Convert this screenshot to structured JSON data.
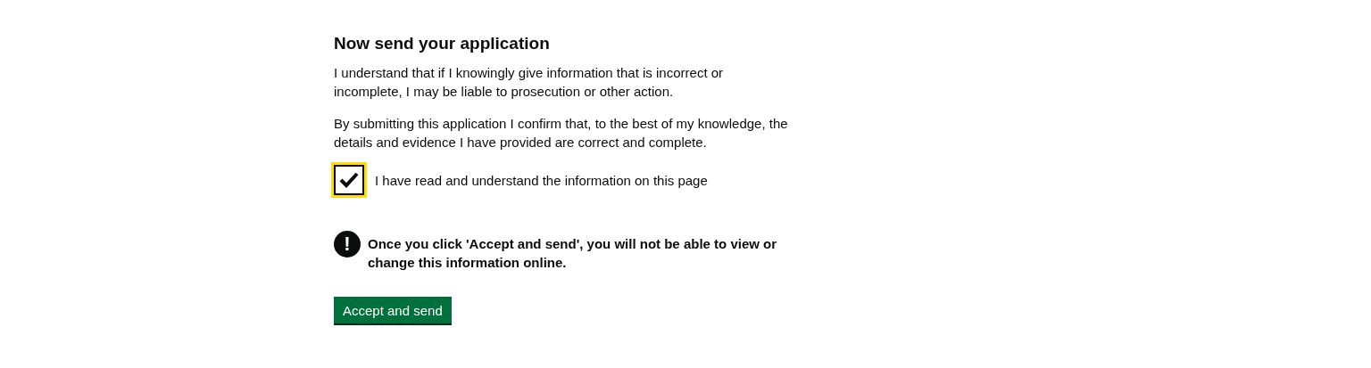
{
  "heading": "Now send your application",
  "paragraphs": [
    "I understand that if I knowingly give information that is incorrect or incomplete, I may be liable to prosecution or other action.",
    "By submitting this application I confirm that, to the best of my knowledge, the details and evidence I have provided are correct and complete."
  ],
  "declaration": {
    "label": "I have read and understand the information on this page",
    "checked": true,
    "focused": true
  },
  "warning": {
    "icon": "!",
    "text": "Once you click 'Accept and send', you will not be able to view or change this information online."
  },
  "buttons": [
    "Accept and send"
  ]
}
